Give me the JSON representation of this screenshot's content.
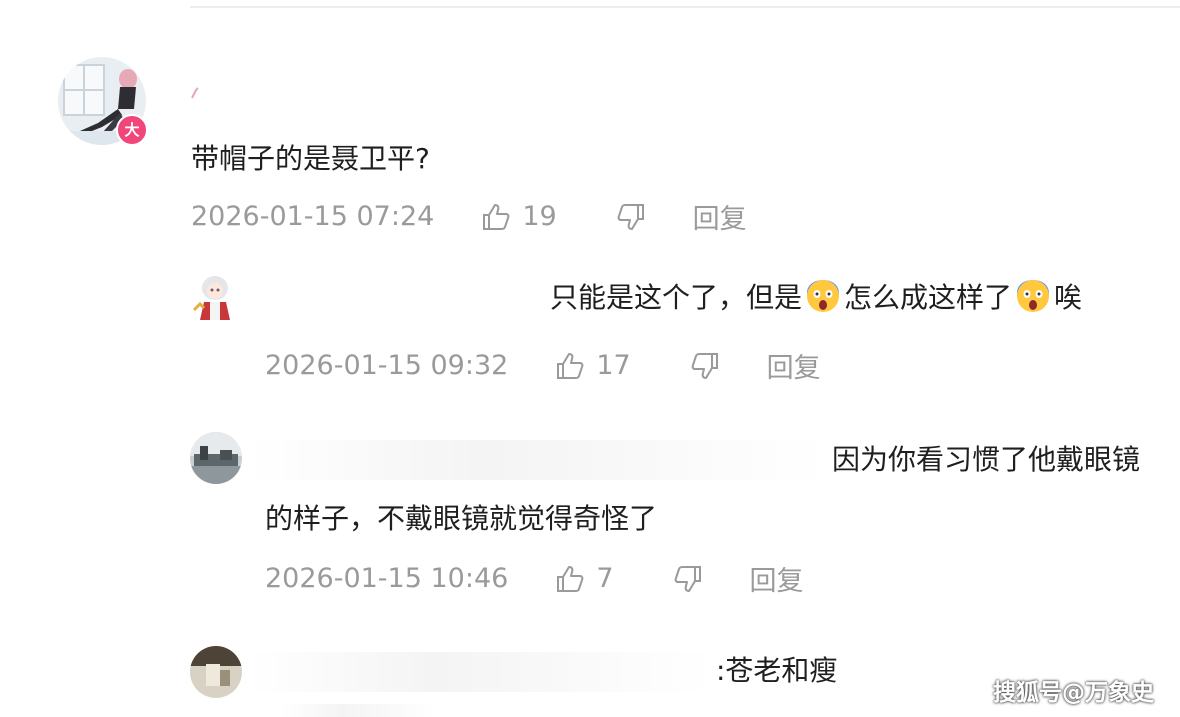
{
  "comments": [
    {
      "text": "带帽子的是聂卫平?",
      "time": "2026-01-15 07:24",
      "likes": "19",
      "reply_label": "回复",
      "badge": "大"
    },
    {
      "text_part1": "只能是这个了，但是",
      "text_part2": "怎么成这样了",
      "text_part3": "唉",
      "emoji": "screaming-face",
      "time": "2026-01-15 09:32",
      "likes": "17",
      "reply_label": "回复"
    },
    {
      "text_line1": "因为你看习惯了他戴眼镜",
      "text_line2": "的样子，不戴眼镜就觉得奇怪了",
      "time": "2026-01-15 10:46",
      "likes": "7",
      "reply_label": "回复"
    },
    {
      "text": ":苍老和瘦"
    }
  ],
  "watermark": "搜狐号@万象史",
  "colors": {
    "meta": "#9a9a9a",
    "badge": "#f0467a",
    "text": "#1f1f1f"
  }
}
